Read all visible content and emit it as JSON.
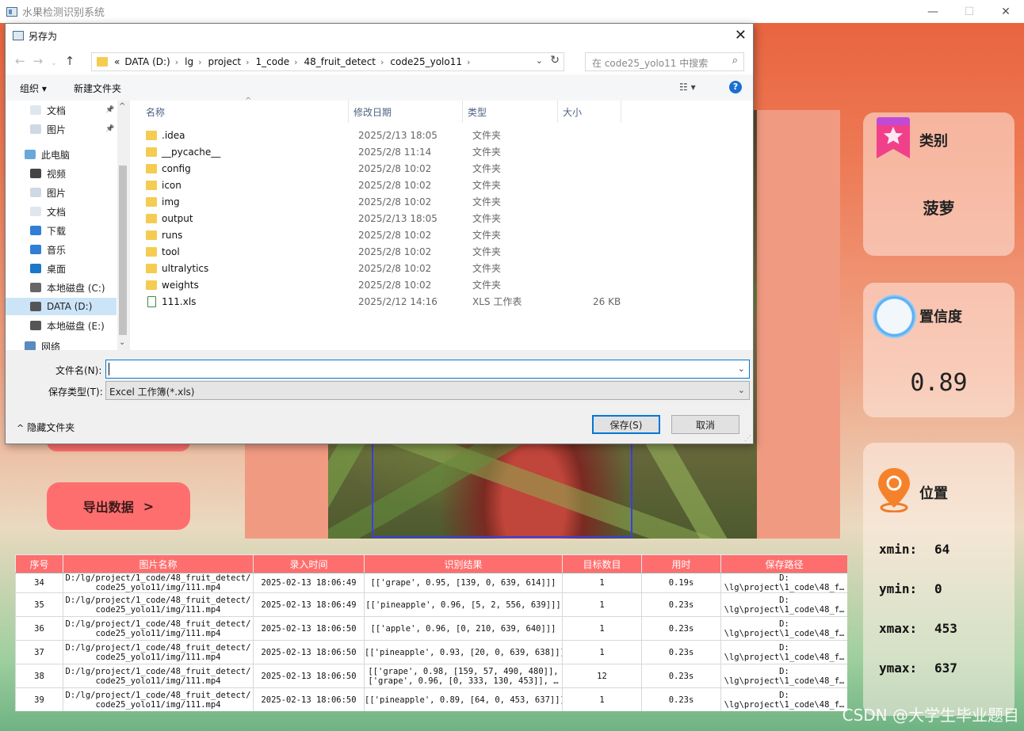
{
  "app": {
    "title": "水果检测识别系统",
    "watermark": "CSDN @大学生毕业题目"
  },
  "window_controls": {
    "minimize": "—",
    "maximize": "☐",
    "close": "✕"
  },
  "left_panel": {
    "export_button": "导出数据",
    "export_chevron": ">"
  },
  "cards": {
    "category": {
      "title": "类别",
      "value": "菠萝"
    },
    "confidence": {
      "title": "置信度",
      "value": "0.89"
    },
    "position": {
      "title": "位置",
      "xmin_label": "xmin:",
      "xmin": "64",
      "ymin_label": "ymin:",
      "ymin": "0",
      "xmax_label": "xmax:",
      "xmax": "453",
      "ymax_label": "ymax:",
      "ymax": "637"
    }
  },
  "table": {
    "headers": [
      "序号",
      "图片名称",
      "录入时间",
      "识别结果",
      "目标数目",
      "用时",
      "保存路径"
    ],
    "rows": [
      {
        "id": "34",
        "name1": "D:/lg/project/1_code/48_fruit_detect/",
        "name2": "code25_yolo11/img/111.mp4",
        "time": "2025-02-13 18:06:49",
        "result1": "[['grape', 0.95, [139, 0, 639, 614]]]",
        "result2": "",
        "count": "1",
        "elapsed": "0.19s",
        "path1": "D:",
        "path2": "\\lg\\project\\1_code\\48_f…"
      },
      {
        "id": "35",
        "name1": "D:/lg/project/1_code/48_fruit_detect/",
        "name2": "code25_yolo11/img/111.mp4",
        "time": "2025-02-13 18:06:49",
        "result1": "[['pineapple', 0.96, [5, 2, 556, 639]]]",
        "result2": "",
        "count": "1",
        "elapsed": "0.23s",
        "path1": "D:",
        "path2": "\\lg\\project\\1_code\\48_f…"
      },
      {
        "id": "36",
        "name1": "D:/lg/project/1_code/48_fruit_detect/",
        "name2": "code25_yolo11/img/111.mp4",
        "time": "2025-02-13 18:06:50",
        "result1": "[['apple', 0.96, [0, 210, 639, 640]]]",
        "result2": "",
        "count": "1",
        "elapsed": "0.23s",
        "path1": "D:",
        "path2": "\\lg\\project\\1_code\\48_f…"
      },
      {
        "id": "37",
        "name1": "D:/lg/project/1_code/48_fruit_detect/",
        "name2": "code25_yolo11/img/111.mp4",
        "time": "2025-02-13 18:06:50",
        "result1": "[['pineapple', 0.93, [20, 0, 639, 638]]]",
        "result2": "",
        "count": "1",
        "elapsed": "0.23s",
        "path1": "D:",
        "path2": "\\lg\\project\\1_code\\48_f…"
      },
      {
        "id": "38",
        "name1": "D:/lg/project/1_code/48_fruit_detect/",
        "name2": "code25_yolo11/img/111.mp4",
        "time": "2025-02-13 18:06:50",
        "result1": "[['grape', 0.98, [159, 57, 490, 480]],",
        "result2": "['grape', 0.96, [0, 333, 130, 453]], …",
        "count": "12",
        "elapsed": "0.23s",
        "path1": "D:",
        "path2": "\\lg\\project\\1_code\\48_f…"
      },
      {
        "id": "39",
        "name1": "D:/lg/project/1_code/48_fruit_detect/",
        "name2": "code25_yolo11/img/111.mp4",
        "time": "2025-02-13 18:06:50",
        "result1": "[['pineapple', 0.89, [64, 0, 453, 637]]]",
        "result2": "",
        "count": "1",
        "elapsed": "0.23s",
        "path1": "D:",
        "path2": "\\lg\\project\\1_code\\48_f…"
      }
    ]
  },
  "dialog": {
    "title": "另存为",
    "close": "✕",
    "breadcrumb": [
      "«",
      "DATA (D:)",
      "lg",
      "project",
      "1_code",
      "48_fruit_detect",
      "code25_yolo11"
    ],
    "search_placeholder": "在 code25_yolo11 中搜索",
    "organize": "组织 ▾",
    "new_folder": "新建文件夹",
    "help": "?",
    "view_icon": "☷ ▾",
    "sidebar": [
      "文档",
      "图片",
      "此电脑",
      "视频",
      "图片",
      "文档",
      "下载",
      "音乐",
      "桌面",
      "本地磁盘 (C:)",
      "DATA (D:)",
      "本地磁盘 (E:)",
      "网络"
    ],
    "columns": [
      "名称",
      "修改日期",
      "类型",
      "大小"
    ],
    "files": [
      {
        "name": ".idea",
        "date": "2025/2/13 18:05",
        "type": "文件夹",
        "size": "",
        "icon": "folder-icon"
      },
      {
        "name": "__pycache__",
        "date": "2025/2/8 11:14",
        "type": "文件夹",
        "size": "",
        "icon": "folder-icon"
      },
      {
        "name": "config",
        "date": "2025/2/8 10:02",
        "type": "文件夹",
        "size": "",
        "icon": "folder-icon"
      },
      {
        "name": "icon",
        "date": "2025/2/8 10:02",
        "type": "文件夹",
        "size": "",
        "icon": "folder-icon"
      },
      {
        "name": "img",
        "date": "2025/2/8 10:02",
        "type": "文件夹",
        "size": "",
        "icon": "folder-icon"
      },
      {
        "name": "output",
        "date": "2025/2/13 18:05",
        "type": "文件夹",
        "size": "",
        "icon": "folder-icon"
      },
      {
        "name": "runs",
        "date": "2025/2/8 10:02",
        "type": "文件夹",
        "size": "",
        "icon": "folder-icon"
      },
      {
        "name": "tool",
        "date": "2025/2/8 10:02",
        "type": "文件夹",
        "size": "",
        "icon": "folder-icon"
      },
      {
        "name": "ultralytics",
        "date": "2025/2/8 10:02",
        "type": "文件夹",
        "size": "",
        "icon": "folder-icon"
      },
      {
        "name": "weights",
        "date": "2025/2/8 10:02",
        "type": "文件夹",
        "size": "",
        "icon": "folder-icon"
      },
      {
        "name": "111.xls",
        "date": "2025/2/12 14:16",
        "type": "XLS 工作表",
        "size": "26 KB",
        "icon": "xls-file-icon"
      }
    ],
    "filename_label": "文件名(N):",
    "filename_value": "",
    "filetype_label": "保存类型(T):",
    "filetype_value": "Excel 工作簿(*.xls)",
    "hide_folders": "隐藏文件夹",
    "save": "保存(S)",
    "cancel": "取消"
  },
  "colors": {
    "accent": "#ff6e6e",
    "table_header": "#ff6e6e",
    "dialog_focus": "#0078d7"
  }
}
